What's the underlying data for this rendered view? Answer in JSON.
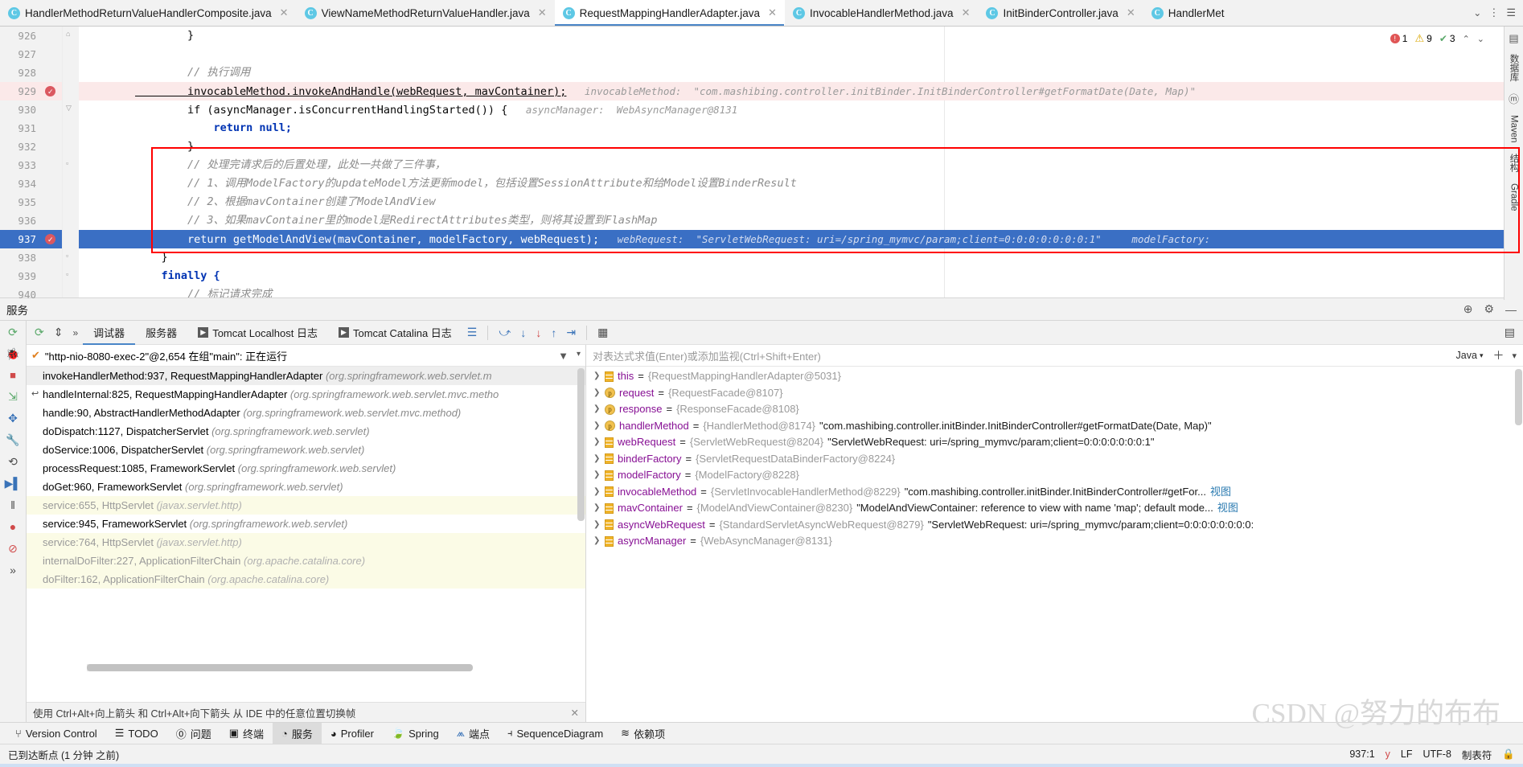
{
  "tabs": [
    {
      "label": "HandlerMethodReturnValueHandlerComposite.java",
      "active": false
    },
    {
      "label": "ViewNameMethodReturnValueHandler.java",
      "active": false
    },
    {
      "label": "RequestMappingHandlerAdapter.java",
      "active": true
    },
    {
      "label": "InvocableHandlerMethod.java",
      "active": false
    },
    {
      "label": "InitBinderController.java",
      "active": false
    },
    {
      "label": "HandlerMet",
      "active": false
    }
  ],
  "editor": {
    "inspection": {
      "errors": "1",
      "warnings": "9",
      "oks": "3"
    },
    "lines": [
      {
        "num": "926",
        "code": "        }",
        "state": "normal"
      },
      {
        "num": "927",
        "code": "",
        "state": "normal"
      },
      {
        "num": "928",
        "comment": "        // 执行调用",
        "state": "normal"
      },
      {
        "num": "929",
        "state": "hl",
        "breakpoint": true,
        "code": "        invocableMethod.invokeAndHandle(webRequest, mavContainer);",
        "hint": "invocableMethod:  \"com.mashibing.controller.initBinder.InitBinderController#getFormatDate(Date, Map)\""
      },
      {
        "num": "930",
        "state": "normal",
        "code": "        if (asyncManager.isConcurrentHandlingStarted()) {",
        "hint": "asyncManager:  WebAsyncManager@8131"
      },
      {
        "num": "931",
        "state": "normal",
        "code": "            return null;"
      },
      {
        "num": "932",
        "state": "normal",
        "code": "        }"
      },
      {
        "num": "933",
        "state": "normal",
        "comment": "        // 处理完请求后的后置处理，此处一共做了三件事，"
      },
      {
        "num": "934",
        "state": "normal",
        "comment": "        // 1、调用ModelFactory的updateModel方法更新model，包括设置SessionAttribute和给Model设置BinderResult"
      },
      {
        "num": "935",
        "state": "normal",
        "comment": "        // 2、根据mavContainer创建了ModelAndView"
      },
      {
        "num": "936",
        "state": "normal",
        "comment": "        // 3、如果mavContainer里的model是RedirectAttributes类型，则将其设置到FlashMap"
      },
      {
        "num": "937",
        "state": "cur",
        "breakpoint": true,
        "code": "        return getModelAndView(mavContainer, modelFactory, webRequest);",
        "hint": "webRequest:  \"ServletWebRequest: uri=/spring_mymvc/param;client=0:0:0:0:0:0:0:1\"     modelFactory:"
      },
      {
        "num": "938",
        "state": "normal",
        "code": "    }"
      },
      {
        "num": "939",
        "state": "normal",
        "code": "    finally {"
      },
      {
        "num": "940",
        "state": "normal",
        "comment": "        // 标记请求完成"
      }
    ],
    "right_toolwindows": [
      "数据库",
      "Maven",
      "结构",
      "Gradle"
    ]
  },
  "services": {
    "title": "服务",
    "header_icons": [
      "target-icon",
      "gear-icon",
      "minimize-icon"
    ],
    "debug_tabs": [
      {
        "label": "调试器",
        "active": true,
        "icon": null
      },
      {
        "label": "服务器",
        "active": false,
        "icon": null
      },
      {
        "label": "Tomcat Localhost 日志",
        "active": false,
        "icon": "log-icon"
      },
      {
        "label": "Tomcat Catalina 日志",
        "active": false,
        "icon": "log-icon"
      }
    ],
    "thread": "\"http-nio-8080-exec-2\"@2,654 在组\"main\": 正在运行",
    "frames": [
      {
        "text": "invokeHandlerMethod:937, RequestMappingHandlerAdapter",
        "pkg": "(org.springframework.web.servlet.m",
        "style": "sel"
      },
      {
        "text": "handleInternal:825, RequestMappingHandlerAdapter",
        "pkg": "(org.springframework.web.servlet.mvc.metho",
        "style": "normal",
        "arrow": true
      },
      {
        "text": "handle:90, AbstractHandlerMethodAdapter",
        "pkg": "(org.springframework.web.servlet.mvc.method)",
        "style": "normal"
      },
      {
        "text": "doDispatch:1127, DispatcherServlet",
        "pkg": "(org.springframework.web.servlet)",
        "style": "normal"
      },
      {
        "text": "doService:1006, DispatcherServlet",
        "pkg": "(org.springframework.web.servlet)",
        "style": "normal"
      },
      {
        "text": "processRequest:1085, FrameworkServlet",
        "pkg": "(org.springframework.web.servlet)",
        "style": "normal"
      },
      {
        "text": "doGet:960, FrameworkServlet",
        "pkg": "(org.springframework.web.servlet)",
        "style": "normal"
      },
      {
        "text": "service:655, HttpServlet",
        "pkg": "(javax.servlet.http)",
        "style": "lib"
      },
      {
        "text": "service:945, FrameworkServlet",
        "pkg": "(org.springframework.web.servlet)",
        "style": "normal"
      },
      {
        "text": "service:764, HttpServlet",
        "pkg": "(javax.servlet.http)",
        "style": "lib"
      },
      {
        "text": "internalDoFilter:227, ApplicationFilterChain",
        "pkg": "(org.apache.catalina.core)",
        "style": "lib"
      },
      {
        "text": "doFilter:162, ApplicationFilterChain",
        "pkg": "(org.apache.catalina.core)",
        "style": "lib"
      }
    ],
    "hint": "使用 Ctrl+Alt+向上箭头 和 Ctrl+Alt+向下箭头 从 IDE 中的任意位置切换帧",
    "watch_placeholder": "对表达式求值(Enter)或添加监视(Ctrl+Shift+Enter)",
    "watch_lang": "Java",
    "variables": [
      {
        "name": "this",
        "badge": "list",
        "type": "{RequestMappingHandlerAdapter@5031}",
        "value": ""
      },
      {
        "name": "request",
        "badge": "p",
        "type": "{RequestFacade@8107}",
        "value": ""
      },
      {
        "name": "response",
        "badge": "p",
        "type": "{ResponseFacade@8108}",
        "value": ""
      },
      {
        "name": "handlerMethod",
        "badge": "p",
        "type": "{HandlerMethod@8174}",
        "value": "\"com.mashibing.controller.initBinder.InitBinderController#getFormatDate(Date, Map)\""
      },
      {
        "name": "webRequest",
        "badge": "list",
        "type": "{ServletWebRequest@8204}",
        "value": "\"ServletWebRequest: uri=/spring_mymvc/param;client=0:0:0:0:0:0:0:1\""
      },
      {
        "name": "binderFactory",
        "badge": "list",
        "type": "{ServletRequestDataBinderFactory@8224}",
        "value": ""
      },
      {
        "name": "modelFactory",
        "badge": "list",
        "type": "{ModelFactory@8228}",
        "value": ""
      },
      {
        "name": "invocableMethod",
        "badge": "list",
        "type": "{ServletInvocableHandlerMethod@8229}",
        "value": "\"com.mashibing.controller.initBinder.InitBinderController#getFor...",
        "link": "视图"
      },
      {
        "name": "mavContainer",
        "badge": "list",
        "type": "{ModelAndViewContainer@8230}",
        "value": "\"ModelAndViewContainer: reference to view with name 'map'; default mode...",
        "link": "视图"
      },
      {
        "name": "asyncWebRequest",
        "badge": "list",
        "type": "{StandardServletAsyncWebRequest@8279}",
        "value": "\"ServletWebRequest: uri=/spring_mymvc/param;client=0:0:0:0:0:0:0:0:",
        "link": ""
      },
      {
        "name": "asyncManager",
        "badge": "list",
        "type": "{WebAsyncManager@8131}",
        "value": ""
      }
    ]
  },
  "bottom_toolbar": [
    {
      "label": "Version Control",
      "icon": "branch-icon",
      "active": false
    },
    {
      "label": "TODO",
      "icon": "list-icon",
      "active": false
    },
    {
      "label": "问题",
      "icon": "warning-icon",
      "active": false
    },
    {
      "label": "终端",
      "icon": "terminal-icon",
      "active": false
    },
    {
      "label": "服务",
      "icon": "services-icon",
      "active": true
    },
    {
      "label": "Profiler",
      "icon": "profiler-icon",
      "active": false
    },
    {
      "label": "Spring",
      "icon": "spring-leaf-icon",
      "active": false
    },
    {
      "label": "端点",
      "icon": "endpoints-icon",
      "active": false
    },
    {
      "label": "SequenceDiagram",
      "icon": "sequence-icon",
      "active": false
    },
    {
      "label": "依赖项",
      "icon": "dependencies-icon",
      "active": false
    }
  ],
  "statusbar": {
    "message": "已到达断点 (1 分钟 之前)",
    "position": "937:1",
    "line_sep": "LF",
    "encoding": "UTF-8",
    "indent": "制表符"
  },
  "watermark": "CSDN @努力的布布"
}
